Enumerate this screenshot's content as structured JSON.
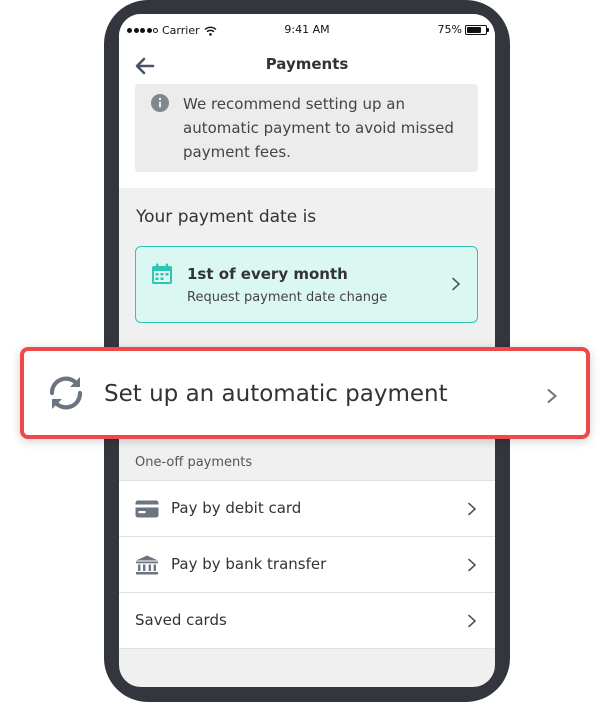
{
  "status_bar": {
    "carrier": "Carrier",
    "time": "9:41 AM",
    "battery": "75%",
    "battery_level": 0.75
  },
  "header": {
    "title": "Payments",
    "back_icon": "arrow-left-icon",
    "info_icon": "info-circle-icon",
    "info_text": "We recommend setting up an automatic payment to avoid missed payment fees."
  },
  "payment_date": {
    "section_title": "Your payment date is",
    "icon": "calendar-icon",
    "value": "1st of every month",
    "action": "Request payment date change"
  },
  "automatic_payment": {
    "icon": "sync-icon",
    "label": "Set up an automatic payment"
  },
  "one_off": {
    "section_label": "One-off payments",
    "items": [
      {
        "icon": "credit-card-icon",
        "label": "Pay by debit card"
      },
      {
        "icon": "bank-icon",
        "label": "Pay by bank transfer"
      },
      {
        "icon": "",
        "label": "Saved cards"
      }
    ]
  },
  "colors": {
    "phone_frame": "#33373d",
    "accent_teal": "#2cc6b5",
    "highlight_red": "#f04848",
    "icon_gray": "#6b7480"
  }
}
